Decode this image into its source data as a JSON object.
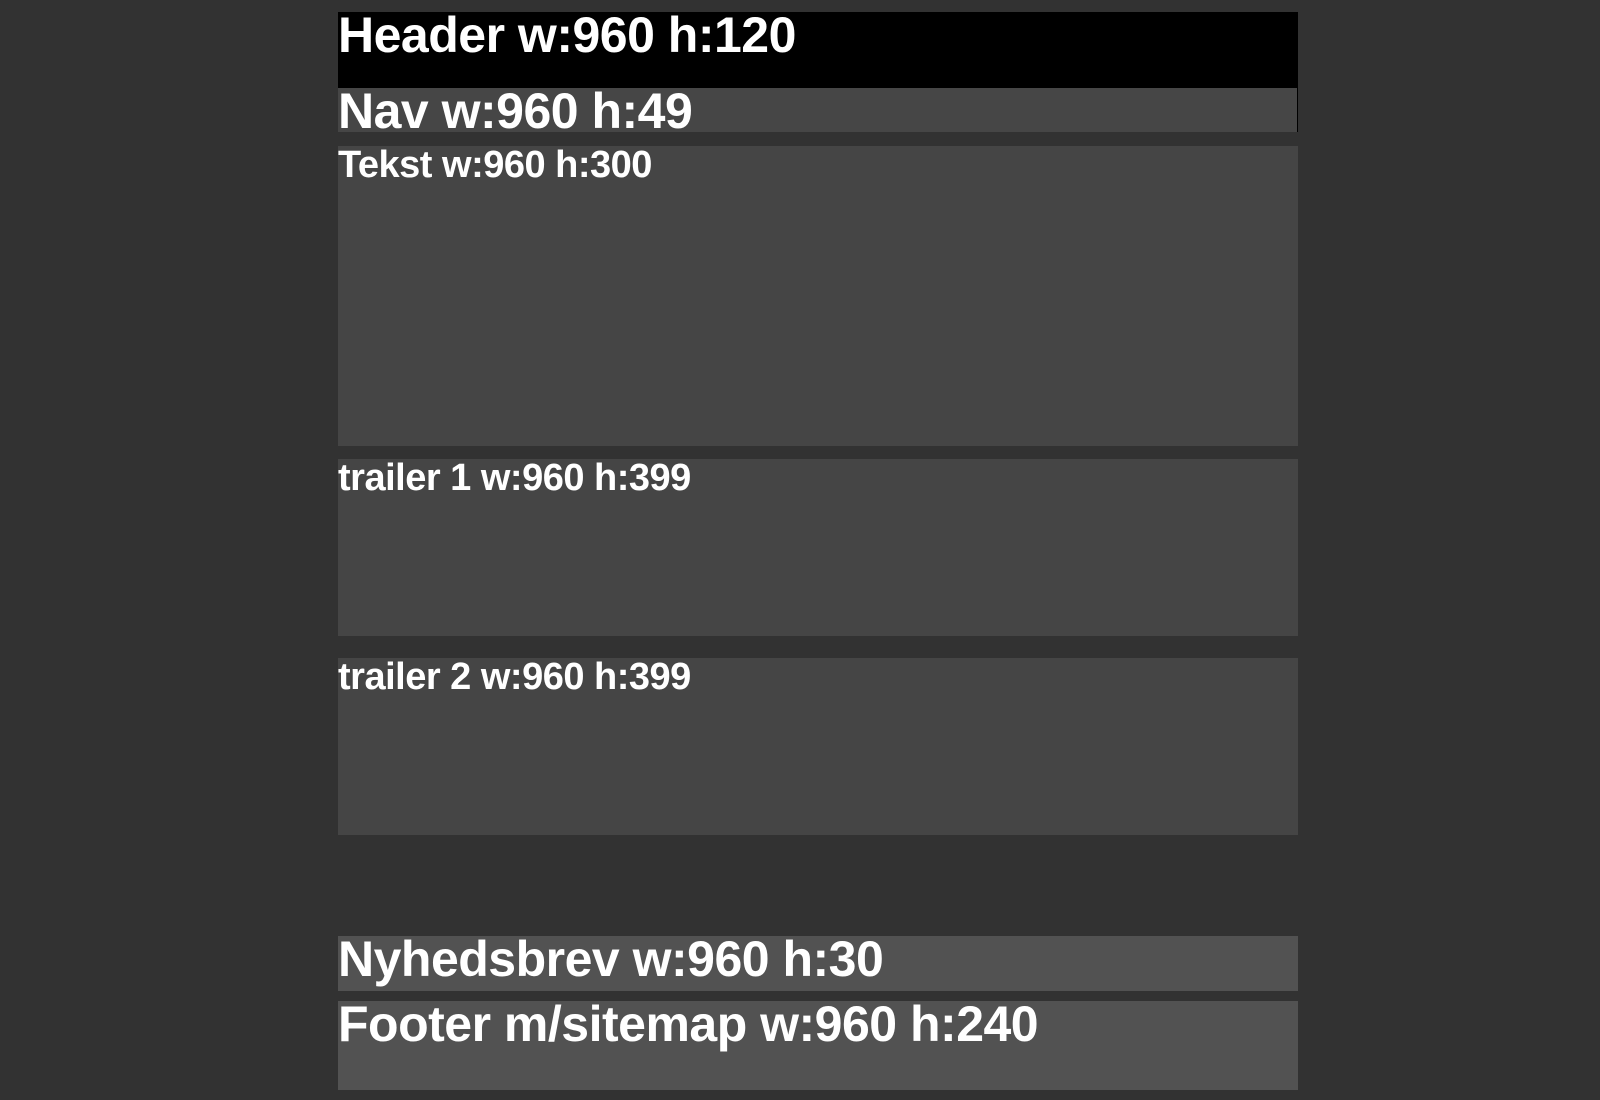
{
  "wireframe": {
    "background_color": "#323232",
    "blocks": [
      {
        "id": "header",
        "label": "Header w:960 h:120",
        "color": "#000000"
      },
      {
        "id": "nav",
        "label": "Nav w:960 h:49",
        "color": "#464646"
      },
      {
        "id": "tekst",
        "label": "Tekst w:960 h:300",
        "color": "#454545"
      },
      {
        "id": "trailer1",
        "label": "trailer 1 w:960 h:399",
        "color": "#454545"
      },
      {
        "id": "trailer2",
        "label": "trailer 2 w:960 h:399",
        "color": "#454545"
      },
      {
        "id": "nyhedsbrev",
        "label": "Nyhedsbrev w:960 h:30",
        "color": "#525252"
      },
      {
        "id": "footer",
        "label": "Footer m/sitemap w:960 h:240",
        "color": "#525252"
      }
    ]
  }
}
